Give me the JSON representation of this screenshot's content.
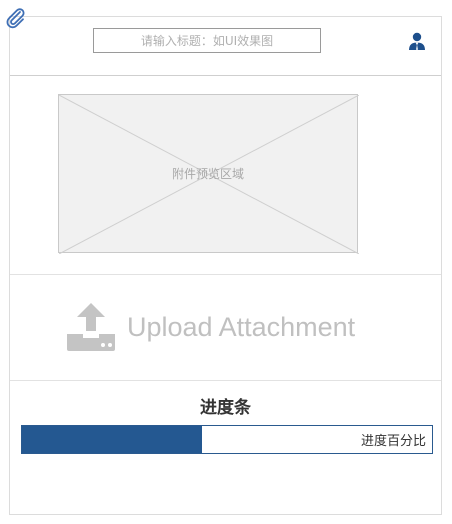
{
  "header": {
    "title_placeholder": "请输入标题：如UI效果图",
    "user_icon": "user-icon",
    "attachment_icon": "paperclip-icon"
  },
  "preview": {
    "label": "附件预览区域"
  },
  "upload": {
    "icon": "upload-icon",
    "label": "Upload Attachment"
  },
  "progress": {
    "title": "进度条",
    "percent": 44,
    "label": "进度百分比"
  },
  "colors": {
    "accent": "#245891",
    "user_icon": "#1d4f8c",
    "clip_icon": "#3f6fb5",
    "upload_icon": "#c4c4c4"
  }
}
